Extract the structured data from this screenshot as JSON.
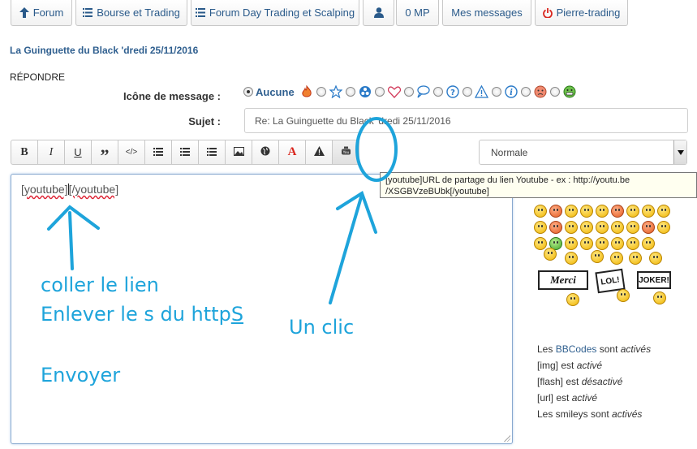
{
  "nav": {
    "forum": "Forum",
    "bourse": "Bourse et Trading",
    "daytrading": "Forum Day Trading et Scalping",
    "mp": "0 MP",
    "messages": "Mes messages",
    "user": "Pierre-trading"
  },
  "thread_title": "La Guinguette du Black 'dredi 25/11/2016",
  "reply_label": "RÉPONDRE",
  "form": {
    "icon_label": "Icône de message :",
    "none_option": "Aucune",
    "subject_label": "Sujet :",
    "subject_value": "Re: La Guinguette du Black 'dredi 25/11/2016",
    "size_select": "Normale"
  },
  "toolbar": {
    "bold": "B",
    "italic": "I",
    "underline": "U",
    "quote": "”",
    "code": "</>",
    "color": "A"
  },
  "tooltip": {
    "line1": "[youtube]URL de partage du lien Youtube - ex : http://youtu.be",
    "line2": "/XSGBVzeBUbk[/youtube]"
  },
  "editor": {
    "open_tag": "[youtube]",
    "close_tag": "[/youtube]"
  },
  "annotations": {
    "paste": "coller le lien",
    "remove_s": "Enlever le s du http",
    "remove_s_letter": "S",
    "send": "Envoyer",
    "click": "Un clic"
  },
  "smiley_signs": {
    "merci": "Merci",
    "lol": "LOL!",
    "joker": "JOKER!"
  },
  "bbcode_info": {
    "l1_a": "Les ",
    "l1_link": "BBCodes",
    "l1_b": " sont ",
    "l1_c": "activés",
    "l2_a": "[img] est ",
    "l2_b": "activé",
    "l3_a": "[flash] est ",
    "l3_b": "désactivé",
    "l4_a": "[url] est ",
    "l4_b": "activé",
    "l5_a": "Les smileys sont ",
    "l5_b": "activés"
  },
  "colors": {
    "annotation": "#1ea4db",
    "link": "#2f5f8f",
    "error_red": "#d9251d"
  }
}
